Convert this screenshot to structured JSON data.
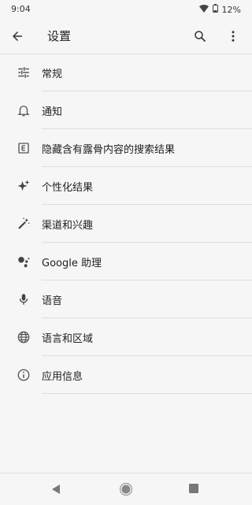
{
  "status": {
    "time": "9:04",
    "battery": "12%"
  },
  "appbar": {
    "title": "设置"
  },
  "items": [
    {
      "label": "常规",
      "icon": "sliders-icon"
    },
    {
      "label": "通知",
      "icon": "bell-icon"
    },
    {
      "label": "隐藏含有露骨内容的搜索结果",
      "icon": "explicit-icon"
    },
    {
      "label": "个性化结果",
      "icon": "sparkles-icon"
    },
    {
      "label": "渠道和兴趣",
      "icon": "magic-wand-icon"
    },
    {
      "label": "Google 助理",
      "icon": "assistant-icon"
    },
    {
      "label": "语音",
      "icon": "microphone-icon"
    },
    {
      "label": "语言和区域",
      "icon": "globe-icon"
    },
    {
      "label": "应用信息",
      "icon": "info-icon"
    }
  ]
}
